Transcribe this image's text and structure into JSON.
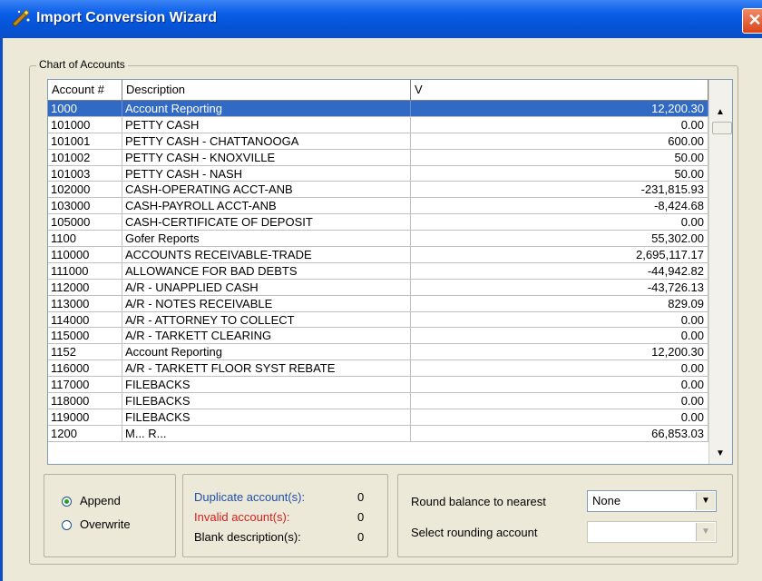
{
  "window": {
    "title": "Import Conversion Wizard",
    "close_glyph": "✕"
  },
  "group": {
    "label": "Chart of Accounts"
  },
  "grid": {
    "columns": [
      "Account #",
      "Description",
      "V"
    ],
    "selected_index": 0,
    "rows": [
      {
        "acct": "1000",
        "desc": "Account Reporting",
        "val": "12,200.30"
      },
      {
        "acct": "101000",
        "desc": "PETTY CASH",
        "val": "0.00"
      },
      {
        "acct": "101001",
        "desc": "PETTY CASH - CHATTANOOGA",
        "val": "600.00"
      },
      {
        "acct": "101002",
        "desc": "PETTY CASH - KNOXVILLE",
        "val": "50.00"
      },
      {
        "acct": "101003",
        "desc": "PETTY CASH - NASH",
        "val": "50.00"
      },
      {
        "acct": "102000",
        "desc": "CASH-OPERATING ACCT-ANB",
        "val": "-231,815.93"
      },
      {
        "acct": "103000",
        "desc": "CASH-PAYROLL ACCT-ANB",
        "val": "-8,424.68"
      },
      {
        "acct": "105000",
        "desc": "CASH-CERTIFICATE OF DEPOSIT",
        "val": "0.00"
      },
      {
        "acct": "1100",
        "desc": "Gofer Reports",
        "val": "55,302.00"
      },
      {
        "acct": "110000",
        "desc": "ACCOUNTS RECEIVABLE-TRADE",
        "val": "2,695,117.17"
      },
      {
        "acct": "111000",
        "desc": "ALLOWANCE FOR BAD DEBTS",
        "val": "-44,942.82"
      },
      {
        "acct": "112000",
        "desc": "A/R - UNAPPLIED CASH",
        "val": "-43,726.13"
      },
      {
        "acct": "113000",
        "desc": "A/R - NOTES RECEIVABLE",
        "val": "829.09"
      },
      {
        "acct": "114000",
        "desc": "A/R - ATTORNEY TO COLLECT",
        "val": "0.00"
      },
      {
        "acct": "115000",
        "desc": "A/R - TARKETT CLEARING",
        "val": "0.00"
      },
      {
        "acct": "1152",
        "desc": "Account Reporting",
        "val": "12,200.30"
      },
      {
        "acct": "116000",
        "desc": "A/R - TARKETT FLOOR SYST REBATE",
        "val": "0.00"
      },
      {
        "acct": "117000",
        "desc": "FILEBACKS",
        "val": "0.00"
      },
      {
        "acct": "118000",
        "desc": "FILEBACKS",
        "val": "0.00"
      },
      {
        "acct": "119000",
        "desc": "FILEBACKS",
        "val": "0.00"
      },
      {
        "acct": "1200",
        "desc": "M... R...",
        "val": "66,853.03"
      }
    ]
  },
  "scrollbar": {
    "up_glyph": "▲",
    "down_glyph": "▼"
  },
  "mode": {
    "append_label": "Append",
    "overwrite_label": "Overwrite",
    "selected": "append"
  },
  "stats": {
    "duplicate_label": "Duplicate account(s):",
    "duplicate_count": "0",
    "invalid_label": "Invalid account(s):",
    "invalid_count": "0",
    "blank_label": "Blank description(s):",
    "blank_count": "0"
  },
  "rounding": {
    "round_label": "Round balance to nearest",
    "round_value": "None",
    "account_label": "Select rounding account",
    "account_value": "",
    "dropdown_glyph": "▼"
  },
  "colors": {
    "selection": "#316ac5",
    "duplicate": "#1f4fa8",
    "invalid": "#d42020",
    "titlebar": "#0553d6"
  }
}
